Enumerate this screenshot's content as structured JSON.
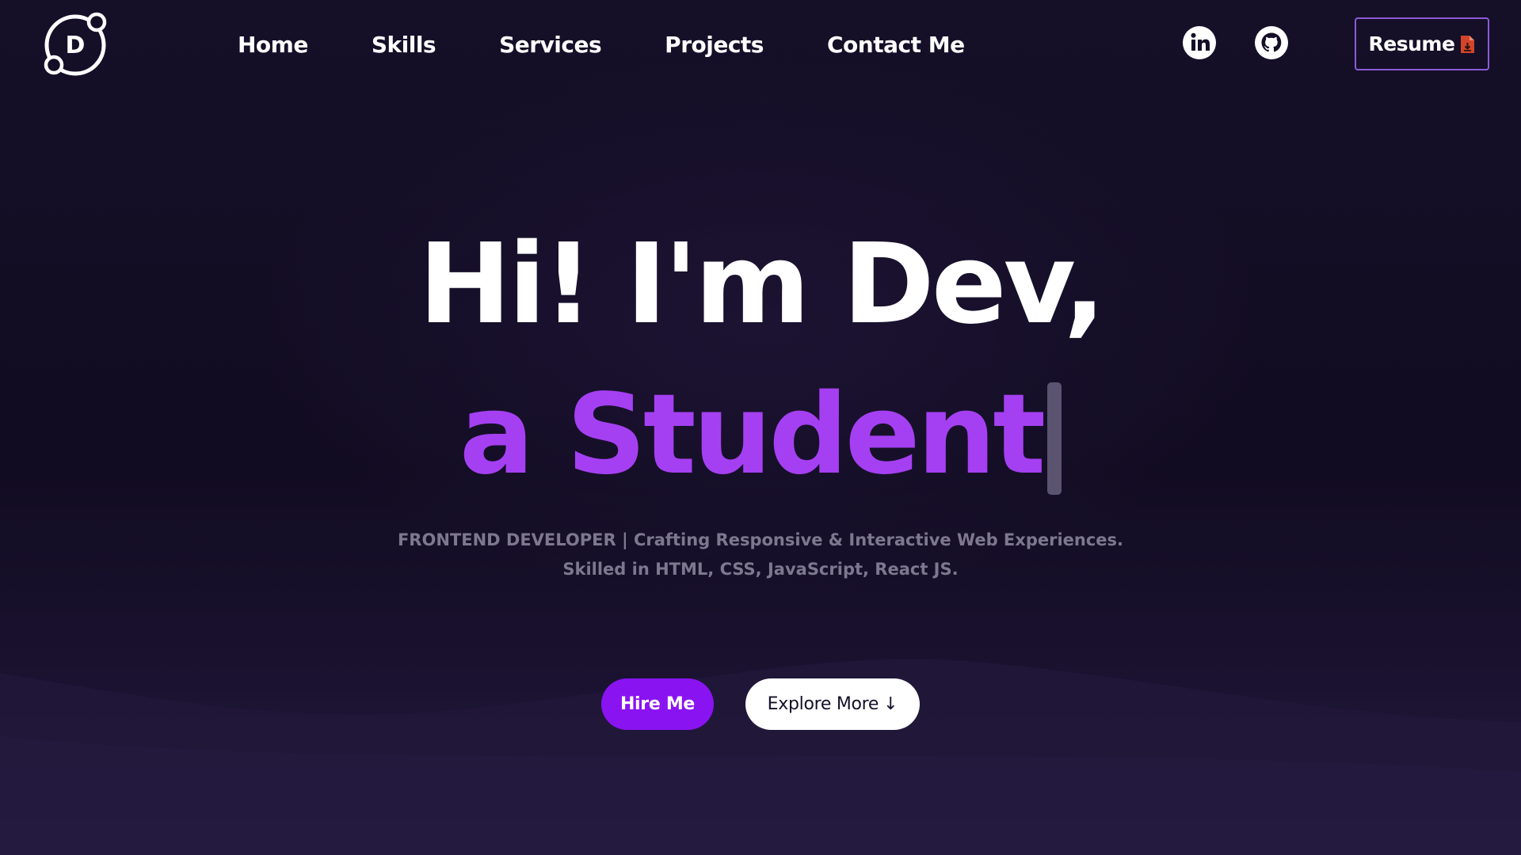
{
  "logo": {
    "letter": "D",
    "icon": "orbit-logo-icon"
  },
  "nav": {
    "items": [
      {
        "label": "Home"
      },
      {
        "label": "Skills"
      },
      {
        "label": "Services"
      },
      {
        "label": "Projects"
      },
      {
        "label": "Contact Me"
      }
    ]
  },
  "social": {
    "linkedin_icon": "linkedin-icon",
    "github_icon": "github-icon"
  },
  "resume": {
    "label": "Resume",
    "icon": "pdf-file-icon"
  },
  "hero": {
    "line1": "Hi! I'm Dev,",
    "line2": "a Student",
    "tagline_line1": "FRONTEND DEVELOPER | Crafting Responsive & Interactive Web Experiences.",
    "tagline_line2": "Skilled in HTML, CSS, JavaScript, React JS."
  },
  "buttons": {
    "hire_label": "Hire Me",
    "explore_label": "Explore More",
    "explore_arrow": "↓"
  },
  "colors": {
    "background": "#140e26",
    "accent_purple": "#a540f2",
    "button_purple": "#8a13f2",
    "resume_border": "#8a5cd6",
    "tagline_gray": "#7d7890",
    "pdf_red": "#d2452a"
  }
}
